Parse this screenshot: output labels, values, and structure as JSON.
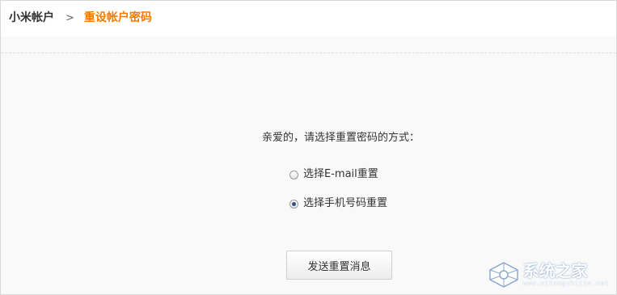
{
  "breadcrumb": {
    "root": "小米帐户",
    "separator": ">",
    "current": "重设帐户密码"
  },
  "form": {
    "prompt": "亲爱的，请选择重置密码的方式：",
    "options": [
      {
        "label": "选择E-mail重置",
        "checked": false
      },
      {
        "label": "选择手机号码重置",
        "checked": true
      }
    ],
    "submit_label": "发送重置消息"
  },
  "watermark": {
    "name": "系统之家",
    "url": "www.xitongzhijia.net"
  },
  "colors": {
    "accent": "#f57a00",
    "text": "#333333",
    "radio_dot": "#2b4f86"
  }
}
